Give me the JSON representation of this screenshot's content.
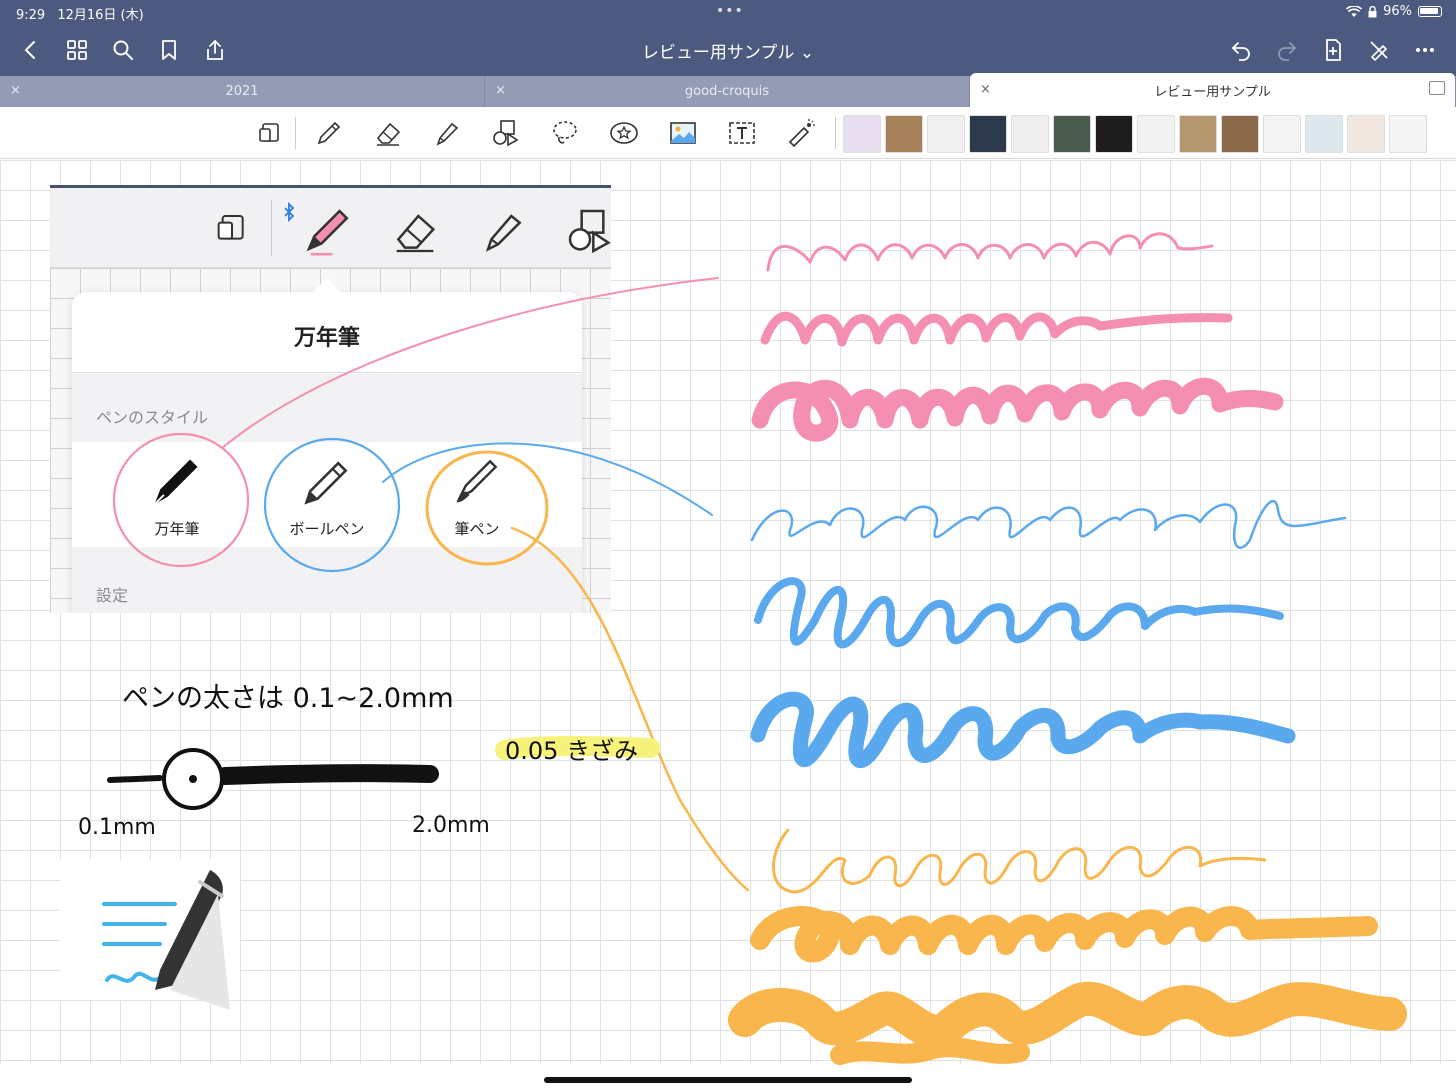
{
  "status": {
    "time": "9:29",
    "date": "12月16日 (木)",
    "dots": "•••",
    "battery": "96%"
  },
  "nav": {
    "title": "レビュー用サンプル ⌄"
  },
  "tabs": [
    {
      "label": "2021",
      "close": "×"
    },
    {
      "label": "good-croquis",
      "close": "×"
    },
    {
      "label": "レビュー用サンプル",
      "close": "×"
    }
  ],
  "toolbar": {
    "tools": [
      "read-mode-icon",
      "pen-icon",
      "eraser-icon",
      "highlighter-icon",
      "shapes-icon",
      "lasso-icon",
      "sticker-icon",
      "image-icon",
      "text-icon",
      "laser-pointer-icon"
    ],
    "thumb_colors": [
      "#e7dff0",
      "#a6825a",
      "#f0f0f0",
      "#2d3a4c",
      "#eeeeee",
      "#4a5a4f",
      "#1d1d1d",
      "#f2f2f2",
      "#b69870",
      "#8b6a4c",
      "#f4f4f4",
      "#dde8ef",
      "#f0e8e0",
      "#f5f5f5"
    ]
  },
  "popover": {
    "title": "万年筆",
    "section_style": "ペンのスタイル",
    "section_settings": "設定",
    "options": [
      "万年筆",
      "ボールペン",
      "筆ペン"
    ]
  },
  "notes": {
    "thickness": "ペンの太さは  0.1~2.0mm",
    "step": "0.05 きざみ",
    "min": "0.1mm",
    "max": "2.0mm"
  },
  "colors": {
    "pink": "#f48fb1",
    "blue": "#5aa9ee",
    "orange": "#f8b64c",
    "highlight": "#f6f27a"
  }
}
